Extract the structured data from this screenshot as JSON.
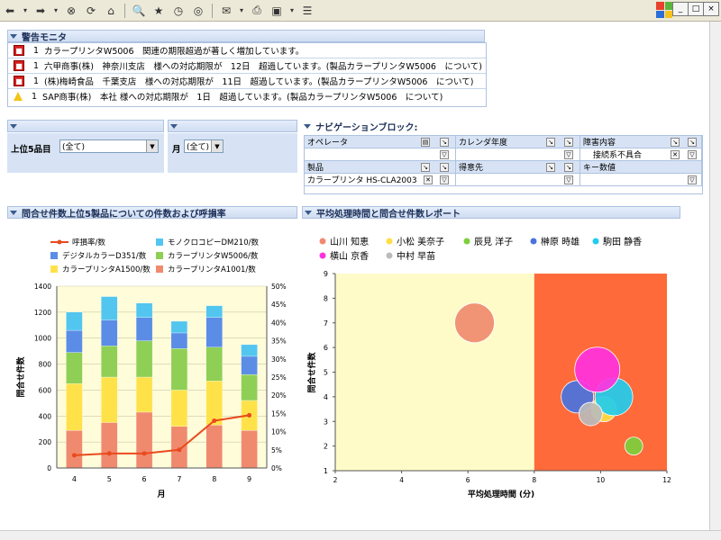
{
  "alert_monitor": {
    "title": "警告モニタ",
    "rows": [
      {
        "level": "error",
        "count": "1",
        "text": "カラープリンタW5006　関連の期限超過が著しく増加しています。"
      },
      {
        "level": "error",
        "count": "1",
        "text": "六甲商事(株)　神奈川支店　様への対応期限が　12日　超過しています。(製品カラープリンタW5006　について)"
      },
      {
        "level": "error",
        "count": "1",
        "text": "(株)梅崎食品　千葉支店　様への対応期限が　11日　超過しています。(製品カラープリンタW5006　について)"
      },
      {
        "level": "warning",
        "count": "1",
        "text": "SAP商事(株)　本社 様への対応期限が　1日　超過しています。(製品カラープリンタW5006　について)"
      }
    ]
  },
  "filters": {
    "top5_label": "上位5品目",
    "top5_value": "(全て)",
    "month_label": "月",
    "month_value": "(全て)"
  },
  "navigation": {
    "title": "ナビゲーションブロック:",
    "headers": {
      "operator": "オペレータ",
      "calendar_year": "カレンダ年度",
      "fault": "障害内容",
      "product": "製品",
      "customer": "得意先",
      "key_figure": "キー数値"
    },
    "values": {
      "fault": "接続系不具合",
      "product": "カラープリンタ HS-CLA2003"
    }
  },
  "chart1_panel": {
    "title": "問合せ件数上位5製品についての件数および呼損率"
  },
  "chart2_panel": {
    "title": "平均処理時間と問合せ件数レポート"
  },
  "chart_data": [
    {
      "type": "bar",
      "stacked": true,
      "categories": [
        "4",
        "5",
        "6",
        "7",
        "8",
        "9"
      ],
      "series": [
        {
          "name": "カラープリンタA1001/数",
          "color": "#f08a6e",
          "values": [
            290,
            350,
            430,
            320,
            330,
            290
          ]
        },
        {
          "name": "カラープリンタA1500/数",
          "color": "#ffe24a",
          "values": [
            360,
            350,
            270,
            280,
            340,
            230
          ]
        },
        {
          "name": "カラープリンタW5006/数",
          "color": "#8fcf55",
          "values": [
            240,
            240,
            280,
            320,
            260,
            200
          ]
        },
        {
          "name": "デジタルカラーD351/数",
          "color": "#5b8de6",
          "values": [
            170,
            200,
            180,
            120,
            230,
            140
          ]
        },
        {
          "name": "モノクロコピーDM210/数",
          "color": "#52c6ef",
          "values": [
            140,
            180,
            110,
            90,
            90,
            90
          ]
        }
      ],
      "line_series": {
        "name": "呼損率/数",
        "color": "#e94b1e",
        "values": [
          3.5,
          4.0,
          4.0,
          5.0,
          13.0,
          14.5
        ]
      },
      "xlabel": "月",
      "ylabel": "問合せ件数",
      "ylim": [
        0,
        1400
      ],
      "y_ticks": [
        "0",
        "200",
        "400",
        "600",
        "800",
        "1000",
        "1200",
        "1400"
      ],
      "y2lim": [
        0,
        50
      ],
      "y2_ticks": [
        "0%",
        "5%",
        "10%",
        "15%",
        "20%",
        "25%",
        "30%",
        "35%",
        "40%",
        "45%",
        "50%"
      ]
    },
    {
      "type": "scatter",
      "series": [
        {
          "name": "山川 知恵",
          "color": "#f08a6e",
          "x": 6.2,
          "y": 7.0,
          "size": 22
        },
        {
          "name": "小松 美奈子",
          "color": "#ffdd44",
          "x": 10.1,
          "y": 3.5,
          "size": 14
        },
        {
          "name": "辰見 洋子",
          "color": "#7ccf3c",
          "x": 11.0,
          "y": 2.0,
          "size": 10
        },
        {
          "name": "榊原 時雄",
          "color": "#4a73e0",
          "x": 9.3,
          "y": 4.0,
          "size": 18
        },
        {
          "name": "駒田 静香",
          "color": "#22ccee",
          "x": 10.4,
          "y": 4.0,
          "size": 21
        },
        {
          "name": "横山 京香",
          "color": "#ff33dd",
          "x": 9.9,
          "y": 5.1,
          "size": 25
        },
        {
          "name": "中村 早苗",
          "color": "#bbbbbb",
          "x": 9.7,
          "y": 3.3,
          "size": 13
        }
      ],
      "xlabel": "平均処理時間 (分)",
      "ylabel": "問合せ件数",
      "xlim": [
        2,
        12
      ],
      "ylim": [
        1,
        9
      ],
      "x_ticks": [
        "2",
        "4",
        "6",
        "8",
        "10",
        "12"
      ],
      "y_ticks": [
        "1",
        "2",
        "3",
        "4",
        "5",
        "6",
        "7",
        "8",
        "9"
      ],
      "bands": [
        {
          "from": 2,
          "to": 8,
          "color": "#fffbc8"
        },
        {
          "from": 8,
          "to": 12,
          "color": "#ff6a3a"
        }
      ]
    }
  ]
}
